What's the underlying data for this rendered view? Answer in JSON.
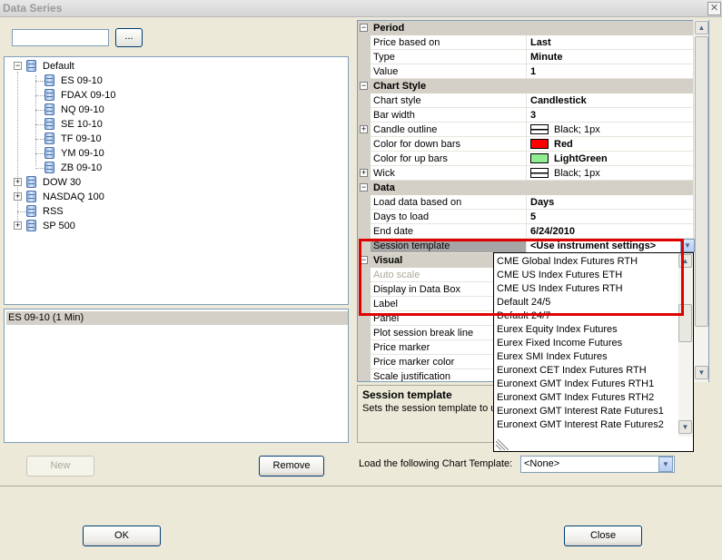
{
  "window": {
    "title": "Data Series",
    "close_glyph": "✕"
  },
  "search": {
    "value": "",
    "browse_label": "..."
  },
  "tree": {
    "nodes": [
      {
        "label": "Default",
        "expander": "−"
      },
      {
        "label": "ES 09-10"
      },
      {
        "label": "FDAX 09-10"
      },
      {
        "label": "NQ 09-10"
      },
      {
        "label": "SE 10-10"
      },
      {
        "label": "TF 09-10"
      },
      {
        "label": "YM 09-10"
      },
      {
        "label": "ZB 09-10"
      },
      {
        "label": "DOW 30",
        "expander": "+"
      },
      {
        "label": "NASDAQ 100",
        "expander": "+"
      },
      {
        "label": "RSS"
      },
      {
        "label": "SP 500",
        "expander": "+"
      }
    ]
  },
  "series_list": {
    "items": [
      "ES 09-10 (1 Min)"
    ]
  },
  "buttons": {
    "new": "New",
    "remove": "Remove",
    "ok": "OK",
    "close": "Close"
  },
  "grid": {
    "rows": [
      {
        "name": "Period",
        "cat": true,
        "expander": "−"
      },
      {
        "name": "Price based on",
        "value": "Last"
      },
      {
        "name": "Type",
        "value": "Minute"
      },
      {
        "name": "Value",
        "value": "1"
      },
      {
        "name": "Chart Style",
        "cat": true,
        "expander": "−"
      },
      {
        "name": "Chart style",
        "value": "Candlestick"
      },
      {
        "name": "Bar width",
        "value": "3"
      },
      {
        "name": "Candle outline",
        "value": "Black; 1px",
        "expander": "+"
      },
      {
        "name": "Color for down bars",
        "value": "Red"
      },
      {
        "name": "Color for up bars",
        "value": "LightGreen"
      },
      {
        "name": "Wick",
        "value": "Black; 1px",
        "expander": "+"
      },
      {
        "name": "Data",
        "cat": true,
        "expander": "−"
      },
      {
        "name": "Load data based on",
        "value": "Days"
      },
      {
        "name": "Days to load",
        "value": "5"
      },
      {
        "name": "End date",
        "value": "6/24/2010"
      },
      {
        "name": "Session template",
        "value": "<Use instrument settings>"
      },
      {
        "name": "Visual",
        "cat": true,
        "expander": "−"
      },
      {
        "name": "Auto scale",
        "value": ""
      },
      {
        "name": "Display in Data Box",
        "value": ""
      },
      {
        "name": "Label",
        "value": ""
      },
      {
        "name": "Panel",
        "value": ""
      },
      {
        "name": "Plot session break line",
        "value": ""
      },
      {
        "name": "Price marker",
        "value": ""
      },
      {
        "name": "Price marker color",
        "value": ""
      },
      {
        "name": "Scale justification",
        "value": ""
      }
    ],
    "colors": {
      "down": "#ff0000",
      "up": "#90ee90",
      "outline": "#ffffff"
    }
  },
  "help": {
    "title": "Session template",
    "description": "Sets the session template to u"
  },
  "dropdown": {
    "items": [
      "CME Global Index Futures RTH",
      "CME US Index Futures ETH",
      "CME US Index Futures RTH",
      "Default 24/5",
      "Default 24/7",
      "Eurex Equity Index Futures",
      "Eurex Fixed Income Futures",
      "Eurex SMI Index Futures",
      "Euronext CET Index Futures RTH",
      "Euronext GMT Index Futures RTH1",
      "Euronext GMT Index Futures RTH2",
      "Euronext GMT Interest Rate Futures1",
      "Euronext GMT Interest Rate Futures2"
    ]
  },
  "template": {
    "label": "Load the following Chart Template:",
    "value": "<None>"
  }
}
